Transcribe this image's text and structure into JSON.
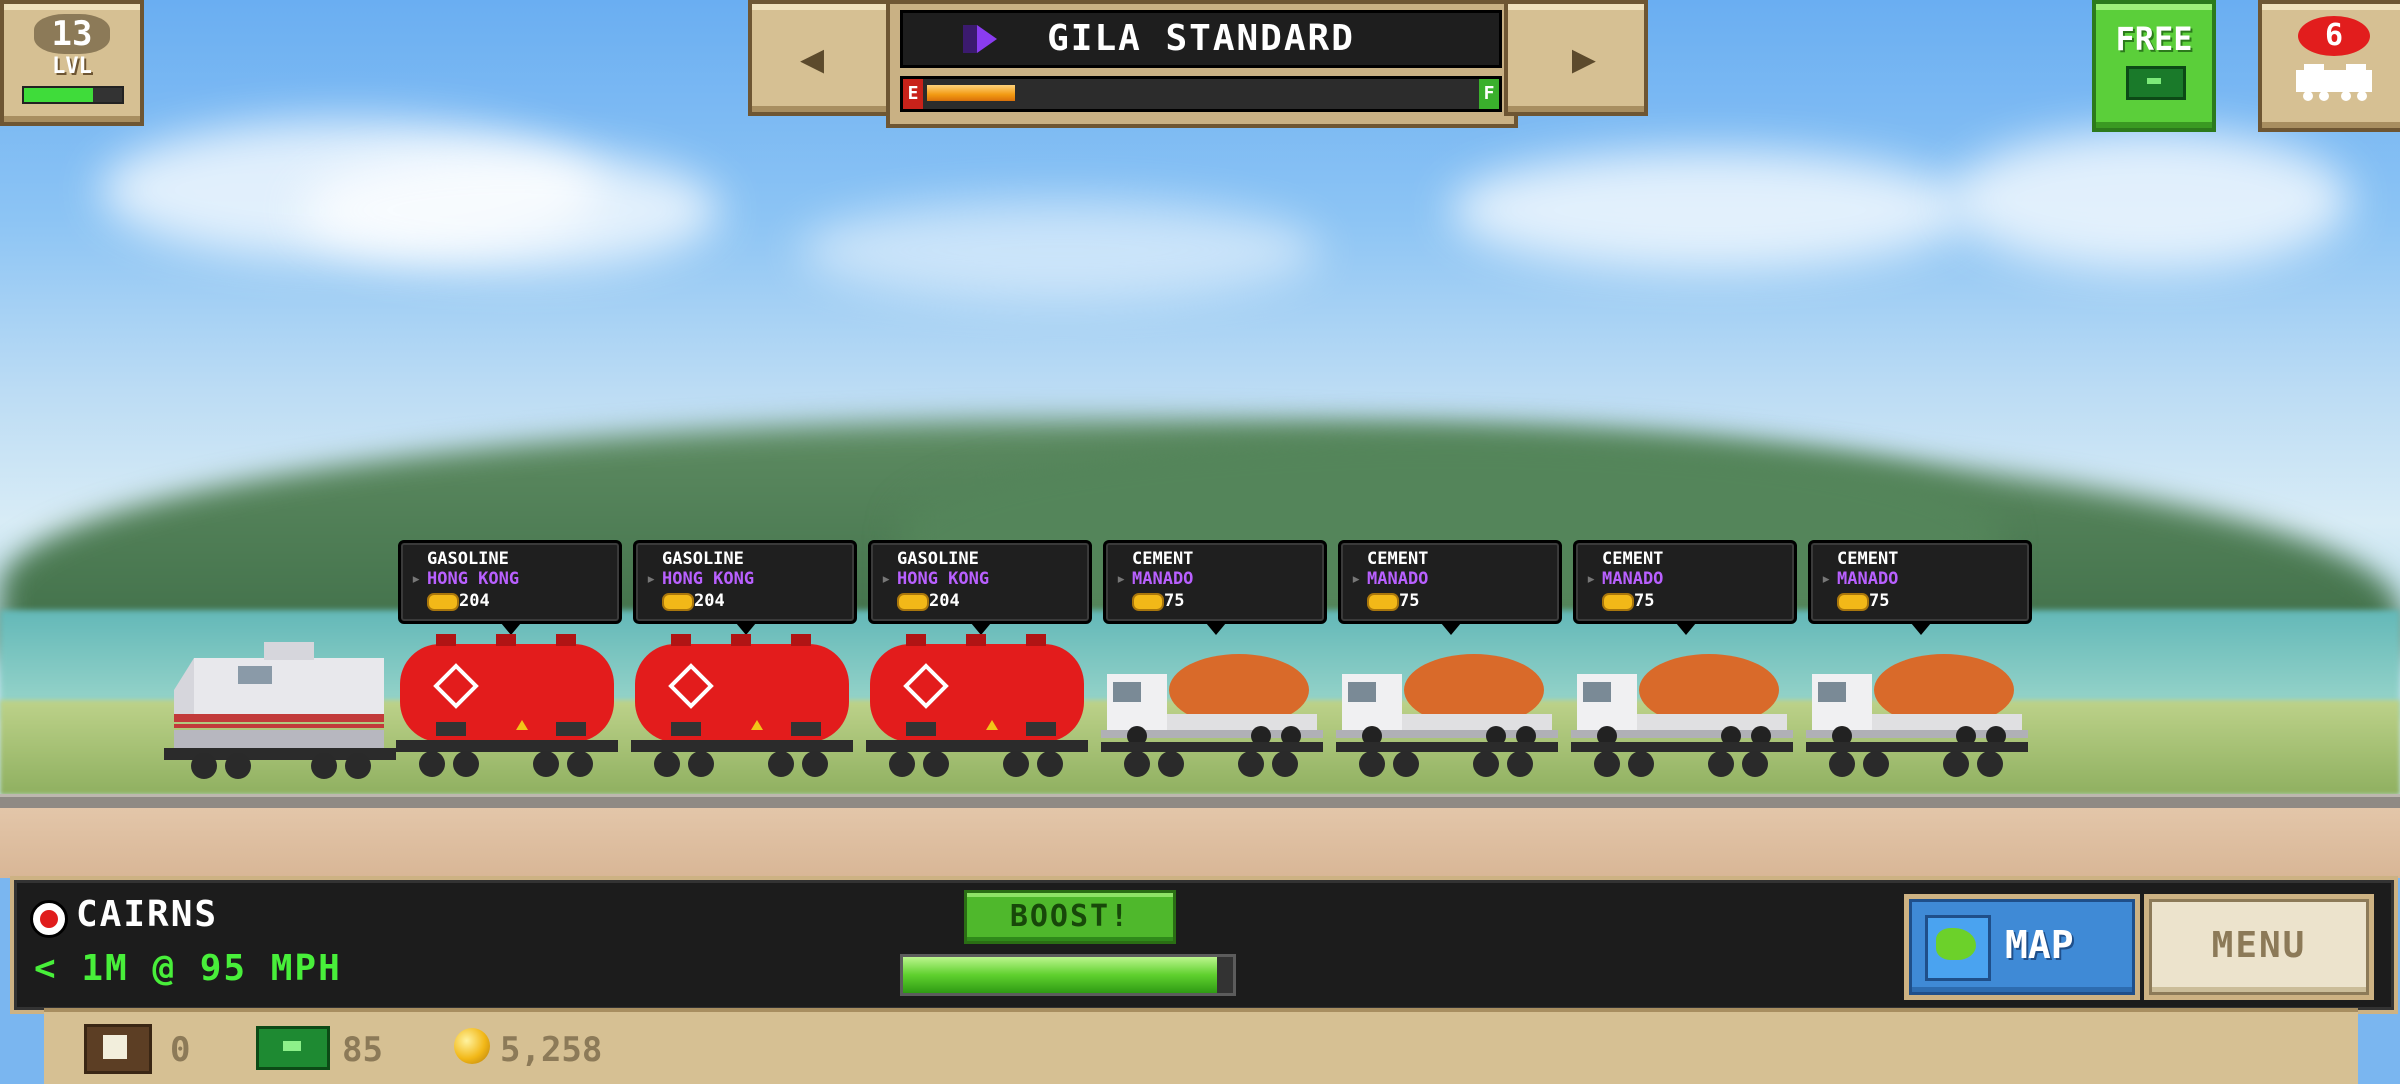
{
  "level": {
    "value": "13",
    "label": "LVL",
    "progress": 0.7
  },
  "train": {
    "name": "GILA STANDARD",
    "fuel_level": 0.16,
    "fuel_empty_label": "E",
    "fuel_full_label": "F"
  },
  "free_button": {
    "label": "FREE"
  },
  "trains_button": {
    "badge": "6"
  },
  "cars": [
    {
      "type": "tanker",
      "cargo": "GASOLINE",
      "destination": "HONG KONG",
      "payout": "204",
      "color": "#e31c1c"
    },
    {
      "type": "tanker",
      "cargo": "GASOLINE",
      "destination": "HONG KONG",
      "payout": "204",
      "color": "#e31c1c"
    },
    {
      "type": "tanker",
      "cargo": "GASOLINE",
      "destination": "HONG KONG",
      "payout": "204",
      "color": "#e31c1c"
    },
    {
      "type": "mixer",
      "cargo": "CEMENT",
      "destination": "MANADO",
      "payout": "75",
      "color": "#d96a2a"
    },
    {
      "type": "mixer",
      "cargo": "CEMENT",
      "destination": "MANADO",
      "payout": "75",
      "color": "#d96a2a"
    },
    {
      "type": "mixer",
      "cargo": "CEMENT",
      "destination": "MANADO",
      "payout": "75",
      "color": "#d96a2a"
    },
    {
      "type": "mixer",
      "cargo": "CEMENT",
      "destination": "MANADO",
      "payout": "75",
      "color": "#d96a2a"
    }
  ],
  "hud": {
    "station": "CAIRNS",
    "speed_text": "< 1M @ 95 MPH",
    "boost_label": "BOOST!",
    "boost_level": 0.95,
    "map_label": "MAP",
    "menu_label": "MENU"
  },
  "currency": {
    "crates": "0",
    "cash": "85",
    "coins": "5,258"
  },
  "icons": {
    "brand": "gila-brand-icon",
    "free_cash": "cash-icon",
    "trains": "locomotive-icon",
    "station": "station-marker-icon",
    "map": "globe-icon",
    "crate": "crate-icon",
    "cash": "cash-icon",
    "coin": "coin-icon"
  },
  "colors": {
    "accent_green": "#48ef3a",
    "panel_tan": "#d6c093",
    "destination_purple": "#b960ff"
  }
}
